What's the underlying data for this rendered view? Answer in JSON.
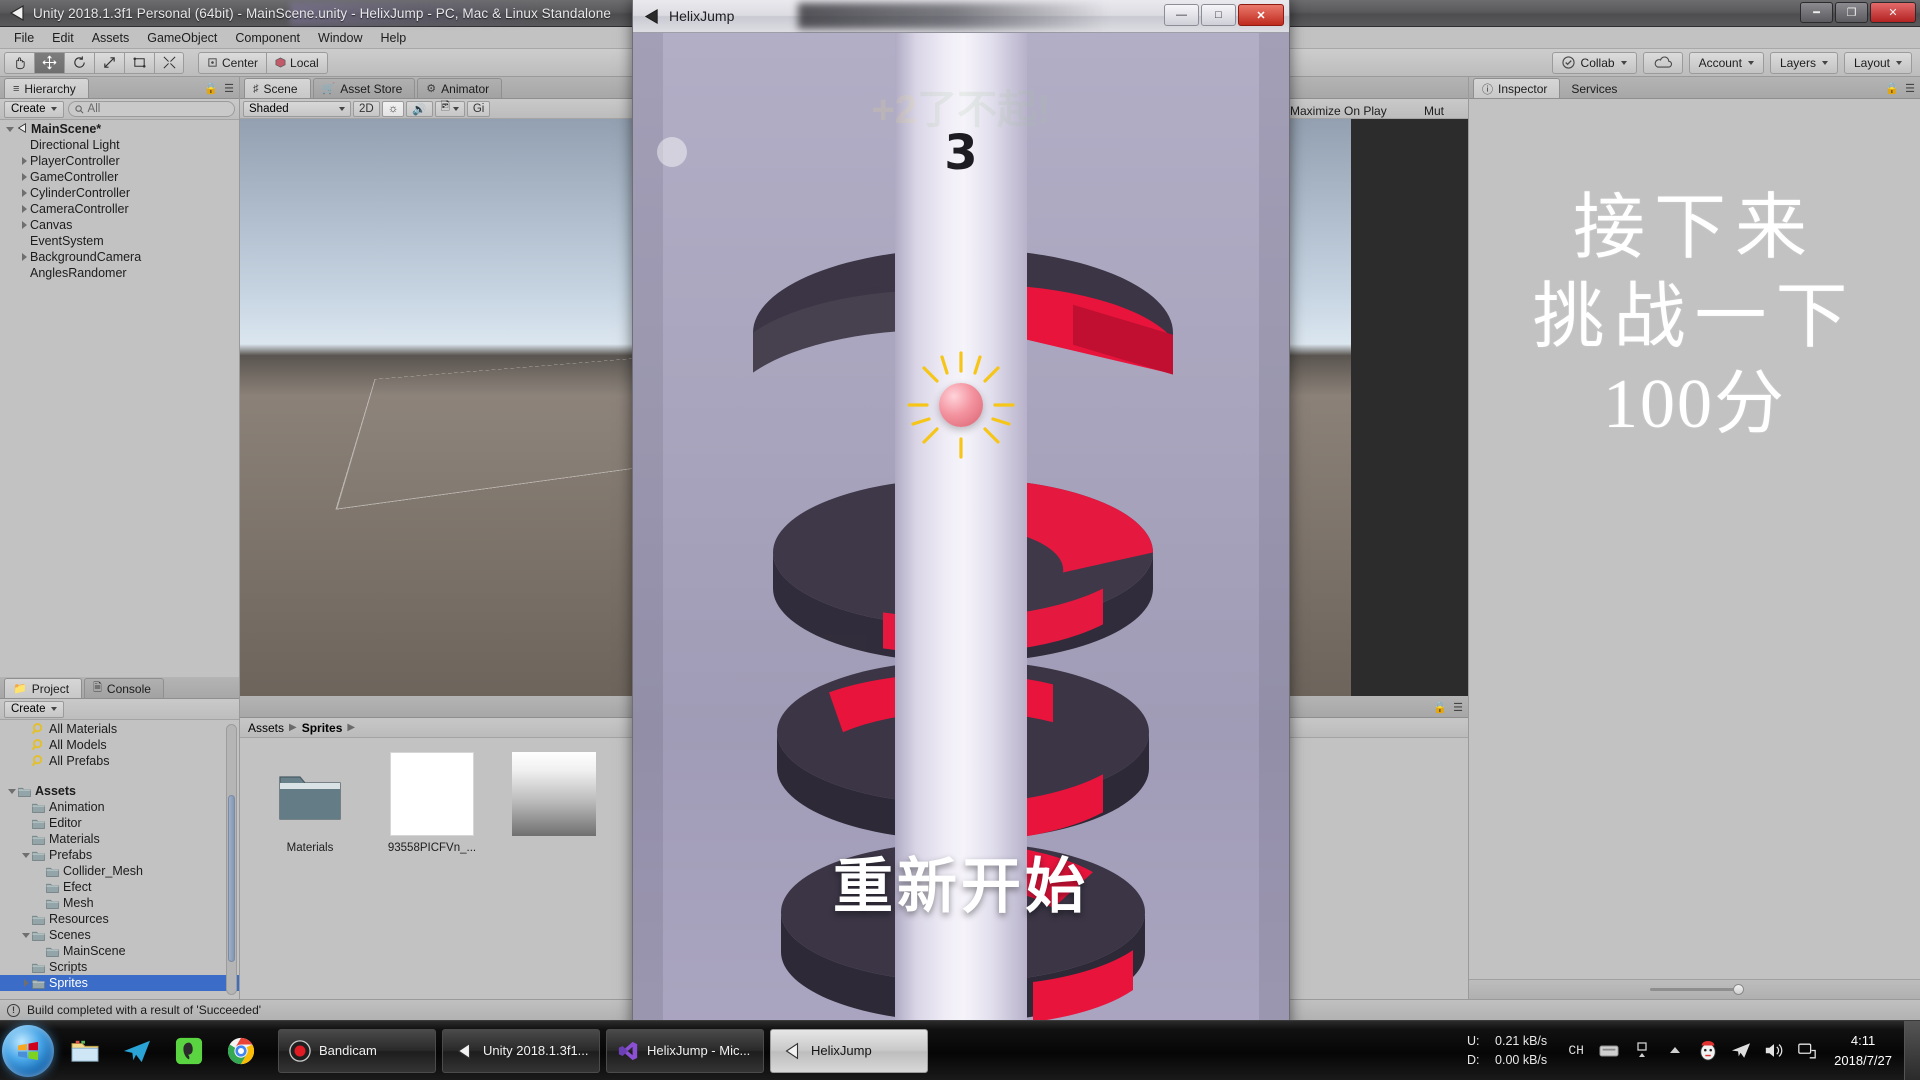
{
  "editor": {
    "title": "Unity 2018.1.3f1 Personal (64bit) - MainScene.unity - HelixJump - PC, Mac & Linux Standalone",
    "menus": [
      "File",
      "Edit",
      "Assets",
      "GameObject",
      "Component",
      "Window",
      "Help"
    ],
    "toolbar": {
      "pivot_label": "Center",
      "space_label": "Local",
      "collab_label": "Collab",
      "account_label": "Account",
      "layers_label": "Layers",
      "layout_label": "Layout",
      "tools": [
        "hand-tool",
        "move-tool",
        "rotate-tool",
        "scale-tool",
        "rect-tool",
        "transform-tool"
      ],
      "active_tool": "move-tool"
    },
    "hierarchy": {
      "tab_label": "Hierarchy",
      "create_label": "Create",
      "search_placeholder": "All",
      "items": [
        {
          "label": "MainScene*",
          "depth": 0,
          "expanded": true,
          "icon": "unity-scene-icon",
          "bold": true
        },
        {
          "label": "Directional Light",
          "depth": 1,
          "expanded": null,
          "icon": "",
          "bold": false
        },
        {
          "label": "PlayerController",
          "depth": 1,
          "expanded": false,
          "icon": "",
          "bold": false
        },
        {
          "label": "GameController",
          "depth": 1,
          "expanded": false,
          "icon": "",
          "bold": false
        },
        {
          "label": "CylinderController",
          "depth": 1,
          "expanded": false,
          "icon": "",
          "bold": false
        },
        {
          "label": "CameraController",
          "depth": 1,
          "expanded": false,
          "icon": "",
          "bold": false
        },
        {
          "label": "Canvas",
          "depth": 1,
          "expanded": false,
          "icon": "",
          "bold": false
        },
        {
          "label": "EventSystem",
          "depth": 1,
          "expanded": null,
          "icon": "",
          "bold": false
        },
        {
          "label": "BackgroundCamera",
          "depth": 1,
          "expanded": false,
          "icon": "",
          "bold": false
        },
        {
          "label": "AnglesRandomer",
          "depth": 1,
          "expanded": null,
          "icon": "",
          "bold": false
        }
      ]
    },
    "scene": {
      "tabs": [
        {
          "label": "Scene",
          "icon": "grid-icon",
          "active": true
        },
        {
          "label": "Asset Store",
          "icon": "store-icon",
          "active": false
        },
        {
          "label": "Animator",
          "icon": "animator-icon",
          "active": false
        }
      ],
      "shading_label": "Shaded",
      "mode_2d_label": "2D",
      "gizmos_label": "Gi",
      "maximize_label": "Maximize On Play",
      "mute_label": "Mut"
    },
    "project": {
      "tabs": [
        {
          "label": "Project",
          "icon": "folder-icon",
          "active": true
        },
        {
          "label": "Console",
          "icon": "console-icon",
          "active": false
        }
      ],
      "create_label": "Create",
      "tree": [
        {
          "label": "All Materials",
          "depth": 1,
          "icon": "search-saved-icon",
          "expanded": null,
          "clipped": true
        },
        {
          "label": "All Models",
          "depth": 1,
          "icon": "search-saved-icon",
          "expanded": null
        },
        {
          "label": "All Prefabs",
          "depth": 1,
          "icon": "search-saved-icon",
          "expanded": null
        },
        {
          "label": "",
          "depth": 0,
          "icon": "",
          "expanded": null,
          "spacer": true
        },
        {
          "label": "Assets",
          "depth": 0,
          "icon": "folder-icon",
          "expanded": true,
          "bold": true
        },
        {
          "label": "Animation",
          "depth": 1,
          "icon": "folder-icon",
          "expanded": null
        },
        {
          "label": "Editor",
          "depth": 1,
          "icon": "folder-icon",
          "expanded": null
        },
        {
          "label": "Materials",
          "depth": 1,
          "icon": "folder-icon",
          "expanded": null
        },
        {
          "label": "Prefabs",
          "depth": 1,
          "icon": "folder-icon",
          "expanded": true
        },
        {
          "label": "Collider_Mesh",
          "depth": 2,
          "icon": "folder-icon",
          "expanded": null
        },
        {
          "label": "Efect",
          "depth": 2,
          "icon": "folder-icon",
          "expanded": null
        },
        {
          "label": "Mesh",
          "depth": 2,
          "icon": "folder-icon",
          "expanded": null
        },
        {
          "label": "Resources",
          "depth": 1,
          "icon": "folder-icon",
          "expanded": null
        },
        {
          "label": "Scenes",
          "depth": 1,
          "icon": "folder-icon",
          "expanded": true
        },
        {
          "label": "MainScene",
          "depth": 2,
          "icon": "folder-icon",
          "expanded": null
        },
        {
          "label": "Scripts",
          "depth": 1,
          "icon": "folder-icon",
          "expanded": null
        },
        {
          "label": "Sprites",
          "depth": 1,
          "icon": "folder-icon",
          "expanded": false,
          "selected": true
        }
      ],
      "breadcrumb": [
        "Assets",
        "Sprites"
      ],
      "assets": [
        {
          "name": "Materials",
          "type": "folder"
        },
        {
          "name": "93558PICFVn_...",
          "type": "image-white"
        },
        {
          "name": "",
          "type": "image-gradient"
        }
      ]
    },
    "inspector": {
      "tabs": [
        {
          "label": "Inspector",
          "icon": "info-icon",
          "active": true
        },
        {
          "label": "Services",
          "icon": "",
          "active": false
        }
      ],
      "overlay_lines": [
        "接下来",
        "挑战一下",
        "100分"
      ]
    },
    "status_bar": {
      "message": "Build completed with a result of 'Succeeded'",
      "icon": "warning-icon"
    }
  },
  "game_window": {
    "title": "HelixJump",
    "icon": "unity-icon",
    "sys_buttons": {
      "minimize": "—",
      "maximize": "□",
      "close": "✕"
    },
    "score": "3",
    "bonus_text_plus": "+2",
    "bonus_text_cn": "了不起!",
    "restart_label": "重新开始",
    "colors": {
      "platform_dark": "#3b3545",
      "platform_red": "#e8143c",
      "cylinder_light": "#efecf6",
      "ball": "#f3939f",
      "background": "#a8a4bd"
    }
  },
  "taskbar": {
    "quick_launch": [
      "explorer-icon",
      "telegram-icon",
      "evernote-icon",
      "chrome-icon"
    ],
    "tasks": [
      {
        "label": "Bandicam",
        "icon": "bandicam-icon",
        "active": false
      },
      {
        "label": "Unity 2018.1.3f1...",
        "icon": "unity-icon",
        "active": false
      },
      {
        "label": "HelixJump - Mic...",
        "icon": "visualstudio-icon",
        "active": false
      },
      {
        "label": "HelixJump",
        "icon": "unity-icon",
        "active": true
      }
    ],
    "network": {
      "up_label": "U:",
      "up_value": "0.21 kB/s",
      "down_label": "D:",
      "down_value": "0.00 kB/s"
    },
    "tray": [
      "CH",
      "keyboard-icon",
      "updown-icon",
      "show-hidden-icon",
      "qq-icon",
      "telegram-icon",
      "volume-icon",
      "network-icon"
    ],
    "ime_label": "CH",
    "clock": {
      "time": "4:11",
      "date": "2018/7/27"
    }
  }
}
